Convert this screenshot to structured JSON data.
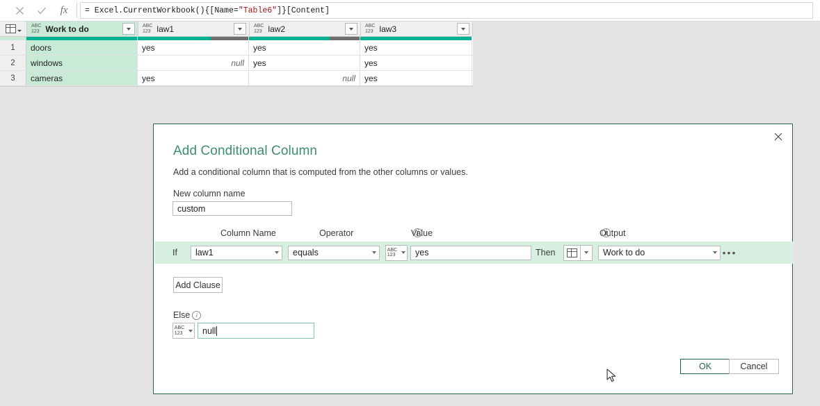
{
  "formula_bar": {
    "cancel_icon": "close-icon",
    "accept_icon": "checkmark-icon",
    "fx_label": "fx",
    "formula_prefix": "= Excel.CurrentWorkbook(){[Name=",
    "formula_string": "\"Table6\"",
    "formula_suffix": "]}[Content]",
    "formula_full": "= Excel.CurrentWorkbook(){[Name=\"Table6\"]}[Content]"
  },
  "grid": {
    "type_icon_label_top": "ABC",
    "type_icon_label_bottom": "123",
    "columns": [
      {
        "name": "Work to do",
        "type": "ABC123",
        "selected": true,
        "quality_valid_pct": 100
      },
      {
        "name": "law1",
        "type": "ABC123",
        "selected": false,
        "quality_valid_pct": 66
      },
      {
        "name": "law2",
        "type": "ABC123",
        "selected": false,
        "quality_valid_pct": 73
      },
      {
        "name": "law3",
        "type": "ABC123",
        "selected": false,
        "quality_valid_pct": 100
      }
    ],
    "rows": [
      {
        "num": "1",
        "cells": [
          "doors",
          "yes",
          "yes",
          "yes"
        ]
      },
      {
        "num": "2",
        "cells": [
          "windows",
          "null",
          "yes",
          "yes"
        ]
      },
      {
        "num": "3",
        "cells": [
          "cameras",
          "yes",
          "null",
          "yes"
        ]
      }
    ],
    "null_text": "null"
  },
  "dialog": {
    "title": "Add Conditional Column",
    "subtitle": "Add a conditional column that is computed from the other columns or values.",
    "close_icon": "close-icon",
    "new_column_name_label": "New column name",
    "new_column_name_value": "custom",
    "headers": {
      "column_name": "Column Name",
      "operator": "Operator",
      "value": "Value",
      "output": "Output"
    },
    "clause": {
      "if_label": "If",
      "column_name": "law1",
      "operator": "equals",
      "value_type": "ABC123",
      "value": "yes",
      "then_label": "Then",
      "output_type_icon": "table-icon",
      "output_value": "Work to do",
      "more_label": "•••"
    },
    "add_clause_label": "Add Clause",
    "else_label": "Else",
    "else_type": "ABC123",
    "else_value": "null",
    "ok_label": "OK",
    "cancel_label": "Cancel"
  },
  "colors": {
    "accent_green": "#3c8f6d",
    "dialog_border": "#2b6b43",
    "clause_row_bg": "#d7efe1",
    "selected_column_bg": "#c9ead7",
    "quality_valid": "#00b294",
    "quality_other": "#6e6e6e",
    "ok_border": "#1f6b3f"
  }
}
